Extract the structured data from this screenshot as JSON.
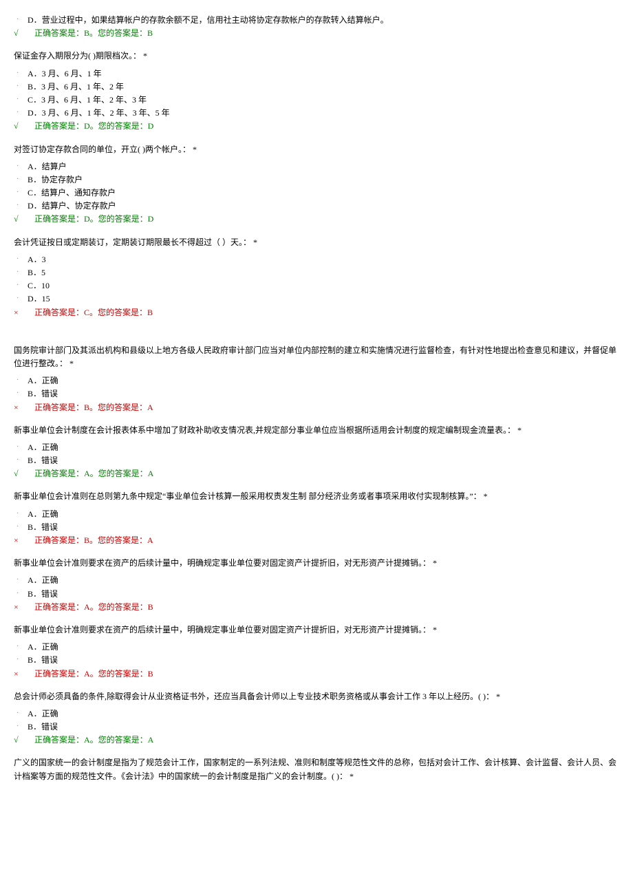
{
  "questions": [
    {
      "prefix_option": "D．营业过程中，如果结算帐户的存款余额不足，信用社主动将协定存款帐户的存款转入结算帐户。",
      "text": "",
      "options": [],
      "result": "correct",
      "mark": "√",
      "answer": "正确答案是：B。您的答案是：B"
    },
    {
      "text": "保证金存入期限分为( )期限档次。：   *",
      "options": [
        "A．3 月、6 月、1 年",
        "B．3 月、6 月、1 年、2 年",
        "C．3 月、6 月、1 年、2 年、3 年",
        "D．3 月、6 月、1 年、2 年、3 年、5 年"
      ],
      "result": "correct",
      "mark": "√",
      "answer": "正确答案是：D。您的答案是：D"
    },
    {
      "text": "对签订协定存款合同的单位，开立( )两个帐户。：   *",
      "options": [
        "A．结算户",
        "B．协定存款户",
        "C．结算户、通知存款户",
        "D．结算户、协定存款户"
      ],
      "result": "correct",
      "mark": "√",
      "answer": "正确答案是：D。您的答案是：D"
    },
    {
      "text": "会计凭证按日或定期装订，定期装订期限最长不得超过（  ）天。：   *",
      "options": [
        "A．3",
        "B．5",
        "C．10",
        "D．15"
      ],
      "result": "wrong",
      "mark": "×",
      "answer": "正确答案是：C。您的答案是：B",
      "spacer_after": true
    },
    {
      "text": "国务院审计部门及其派出机构和县级以上地方各级人民政府审计部门应当对单位内部控制的建立和实施情况进行监督检查，有针对性地提出检查意见和建议，并督促单位进行整改。：   *",
      "options": [
        "A．正确",
        "B．错误"
      ],
      "result": "wrong",
      "mark": "×",
      "answer": "正确答案是：B。您的答案是：A"
    },
    {
      "text": "新事业单位会计制度在会计报表体系中增加了财政补助收支情况表,并规定部分事业单位应当根据所适用会计制度的规定编制现金流量表。：   *",
      "options": [
        "A．正确",
        "B．错误"
      ],
      "result": "correct",
      "mark": "√",
      "answer": "正确答案是：A。您的答案是：A"
    },
    {
      "text": "新事业单位会计准则在总则第九条中规定“事业单位会计核算一般采用权责发生制 部分经济业务或者事项采用收付实现制核算。”：   *",
      "options": [
        "A．正确",
        "B．错误"
      ],
      "result": "wrong",
      "mark": "×",
      "answer": "正确答案是：B。您的答案是：A"
    },
    {
      "text": "新事业单位会计准则要求在资产的后续计量中，明确规定事业单位要对固定资产计提折旧，对无形资产计提摊销。：   *",
      "options": [
        "A．正确",
        "B．错误"
      ],
      "result": "wrong",
      "mark": "×",
      "answer": "正确答案是：A。您的答案是：B"
    },
    {
      "text": "新事业单位会计准则要求在资产的后续计量中，明确规定事业单位要对固定资产计提折旧，对无形资产计提摊销。：   *",
      "options": [
        "A．正确",
        "B．错误"
      ],
      "result": "wrong",
      "mark": "×",
      "answer": "正确答案是：A。您的答案是：B"
    },
    {
      "text": "总会计师必须具备的条件,除取得会计从业资格证书外，还应当具备会计师以上专业技术职务资格或从事会计工作 3 年以上经历。( )：   *",
      "options": [
        "A．正确",
        "B．错误"
      ],
      "result": "correct",
      "mark": "√",
      "answer": "正确答案是：A。您的答案是：A"
    },
    {
      "text": "广义的国家统一的会计制度是指为了规范会计工作，国家制定的一系列法规、准则和制度等规范性文件的总称，包括对会计工作、会计核算、会计监督、会计人员、会计档案等方面的规范性文件。《会计法》中的国家统一的会计制度是指广义的会计制度。( )：   *",
      "options": [],
      "no_answer": true
    }
  ]
}
